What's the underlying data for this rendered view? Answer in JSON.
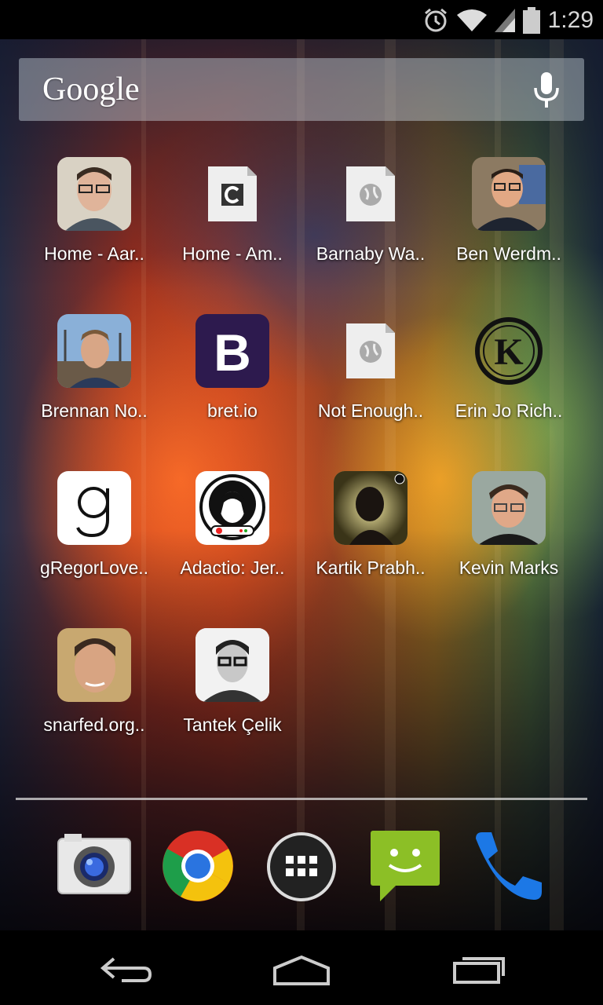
{
  "status_bar": {
    "time": "1:29",
    "icons": [
      "alarm-icon",
      "wifi-icon",
      "cell-signal-icon",
      "battery-icon"
    ]
  },
  "search": {
    "logo_text": "Google",
    "icon": "mic-icon"
  },
  "apps": [
    {
      "label": "Home - Aar..",
      "icon": "avatar-man-glasses"
    },
    {
      "label": "Home - Am..",
      "icon": "document-c-icon"
    },
    {
      "label": "Barnaby Wa..",
      "icon": "document-globe-icon"
    },
    {
      "label": "Ben Werdm..",
      "icon": "avatar-man-smiling"
    },
    {
      "label": "Brennan No..",
      "icon": "avatar-man-outdoors"
    },
    {
      "label": "bret.io",
      "icon": "bootstrap-b-icon"
    },
    {
      "label": "Not Enough..",
      "icon": "document-globe-icon"
    },
    {
      "label": "Erin Jo Rich..",
      "icon": "k-circle-logo"
    },
    {
      "label": "gRegorLove..",
      "icon": "g-letter-icon"
    },
    {
      "label": "Adactio: Jer..",
      "icon": "astronaut-icon"
    },
    {
      "label": "Kartik Prabh..",
      "icon": "avatar-silhouette"
    },
    {
      "label": "Kevin Marks",
      "icon": "avatar-man-glasses-grey"
    },
    {
      "label": "snarfed.org..",
      "icon": "avatar-man-closeup"
    },
    {
      "label": "Tantek Çelik",
      "icon": "avatar-man-bw"
    }
  ],
  "dock": [
    {
      "name": "camera",
      "icon": "camera-icon"
    },
    {
      "name": "chrome",
      "icon": "chrome-icon"
    },
    {
      "name": "app-drawer",
      "icon": "app-drawer-icon"
    },
    {
      "name": "messaging",
      "icon": "messaging-icon"
    },
    {
      "name": "phone",
      "icon": "phone-icon"
    }
  ],
  "nav": [
    {
      "name": "back",
      "icon": "back-icon"
    },
    {
      "name": "home",
      "icon": "home-icon"
    },
    {
      "name": "recents",
      "icon": "recents-icon"
    }
  ],
  "colors": {
    "search_bg": "#c8d2dc",
    "bootstrap_purple": "#2d1a4e",
    "messaging_green": "#8cbf26",
    "phone_blue": "#1c78e6"
  }
}
